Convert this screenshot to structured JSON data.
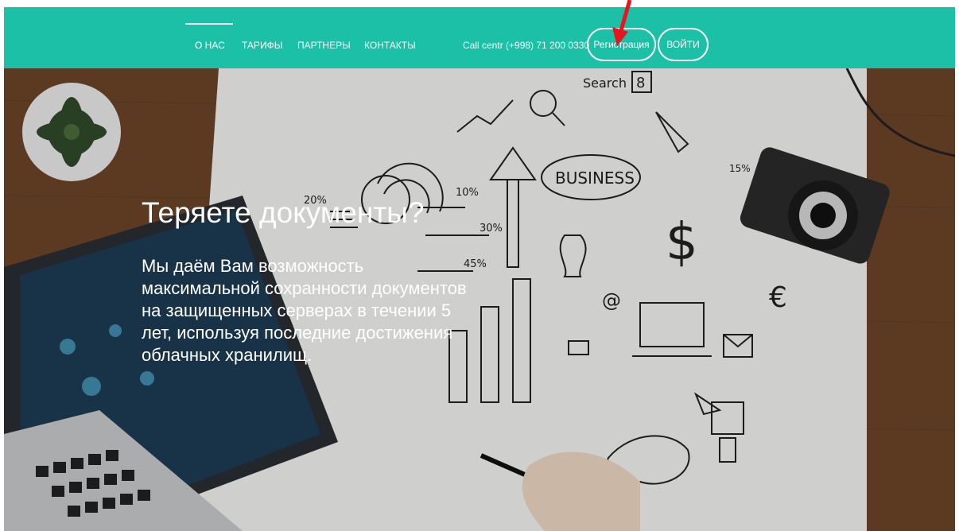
{
  "nav": {
    "items": [
      {
        "label": "О НАС"
      },
      {
        "label": "ТАРИФЫ"
      },
      {
        "label": "ПАРТНЕРЫ"
      },
      {
        "label": "КОНТАКТЫ"
      }
    ],
    "call_centre": "Call centr (+998) 71 200 0330",
    "register_label": "Регистрация",
    "login_label": "ВОЙТИ"
  },
  "hero": {
    "title": "Теряете документы?",
    "text": "Мы даём Вам возможность максимальной сохранности документов на защищенных серверах в течении 5 лет, используя последние достижения облачных хранилищ."
  },
  "illustration": {
    "labels": [
      "Search",
      "8",
      "BUSINESS",
      "20%",
      "10%",
      "30%",
      "45%",
      "15%",
      "$",
      "@",
      "€"
    ]
  },
  "colors": {
    "navbar": "#1cc0a6",
    "desk": "#6e4a2a",
    "paper": "#f4f4f2",
    "annotation_arrow": "#e8141e"
  }
}
